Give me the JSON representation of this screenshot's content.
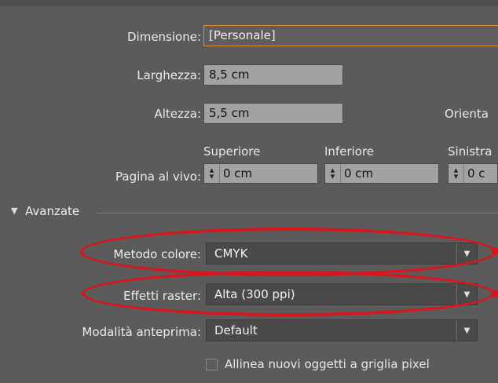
{
  "size": {
    "dimension_label": "Dimensione:",
    "dimension_value": "[Personale]",
    "width_label": "Larghezza:",
    "width_value": "8,5 cm",
    "height_label": "Altezza:",
    "height_value": "5,5 cm",
    "orientation_label": "Orienta"
  },
  "bleed": {
    "label": "Pagina al vivo:",
    "top_label": "Superiore",
    "top_value": "0 cm",
    "bottom_label": "Inferiore",
    "bottom_value": "0 cm",
    "left_label": "Sinistra",
    "left_value": "0 c"
  },
  "advanced": {
    "section_title": "Avanzate",
    "color_mode_label": "Metodo colore:",
    "color_mode_value": "CMYK",
    "raster_label": "Effetti raster:",
    "raster_value": "Alta (300 ppi)",
    "preview_label": "Modalità anteprima:",
    "preview_value": "Default",
    "align_pixel_label": "Allinea nuovi oggetti a griglia pixel",
    "align_pixel_checked": false
  },
  "icons": {
    "section_toggle": "triangle-down-icon",
    "dropdown_arrow": "triangle-down-icon",
    "spinner": "up-down-arrows-icon"
  },
  "colors": {
    "panel_bg": "#5b5b5b",
    "accent_border": "#e48a2e",
    "highlight_ring": "#d8161d"
  }
}
